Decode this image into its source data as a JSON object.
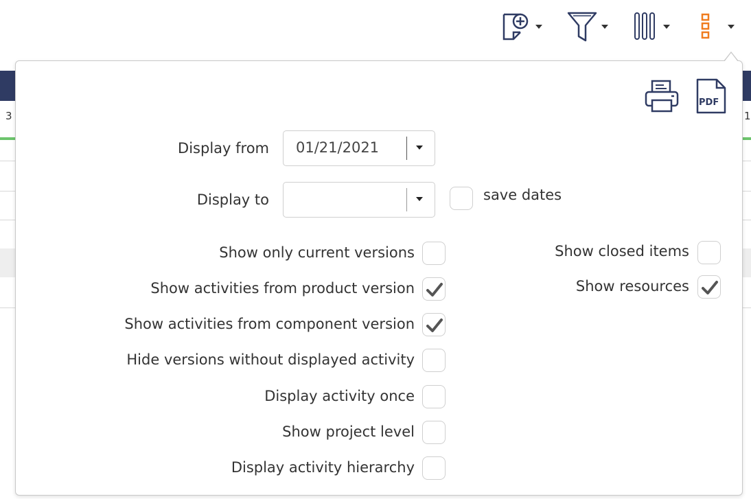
{
  "toolbar": {
    "items": [
      {
        "icon": "add-view-icon"
      },
      {
        "icon": "filter-icon"
      },
      {
        "icon": "columns-icon"
      },
      {
        "icon": "options-icon",
        "color": "#f07c1e"
      }
    ]
  },
  "background": {
    "header_color": "#2f3b63",
    "left_cell_text": "3",
    "right_cell_text": "1"
  },
  "popup": {
    "actions": {
      "print_icon": "printer-icon",
      "pdf_icon": "pdf-icon",
      "pdf_label": "PDF"
    },
    "display_from": {
      "label": "Display from",
      "value": "01/21/2021"
    },
    "display_to": {
      "label": "Display to",
      "value": ""
    },
    "save_dates": {
      "label": "save dates",
      "checked": false
    },
    "options_left": [
      {
        "label": "Show only current versions",
        "checked": false
      },
      {
        "label": "Show activities from product version",
        "checked": true
      },
      {
        "label": "Show activities from component version",
        "checked": true
      },
      {
        "label": "Hide versions without displayed activity",
        "checked": false
      },
      {
        "label": "Display activity once",
        "checked": false
      },
      {
        "label": "Show project level",
        "checked": false
      },
      {
        "label": "Display activity hierarchy",
        "checked": false
      }
    ],
    "options_right": [
      {
        "label": "Show closed items",
        "checked": false
      },
      {
        "label": "Show resources",
        "checked": true
      }
    ]
  }
}
